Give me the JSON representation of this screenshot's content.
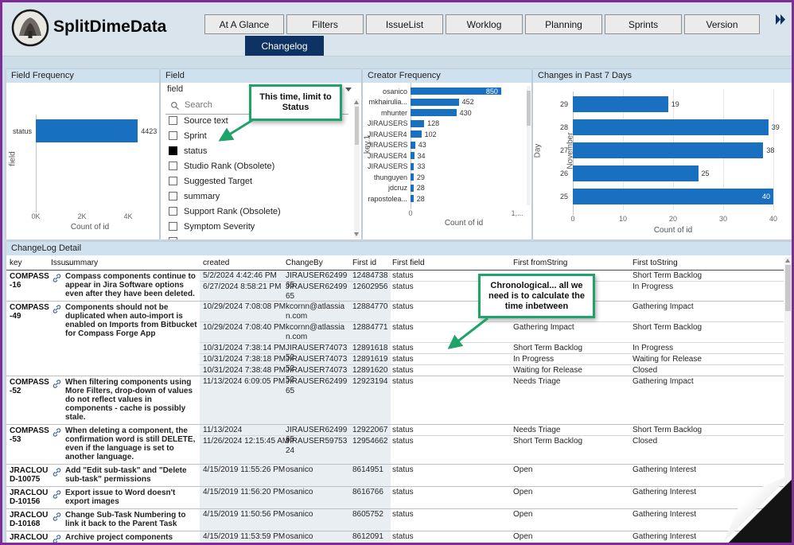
{
  "colors": {
    "bar": "#1a70c0",
    "navy": "#0e3263",
    "green": "#1ea36b",
    "panel_title": "#cfe0ee",
    "page_bg": "#cddde8",
    "header_bg": "#d9e4ec",
    "border_purple": "#7c2d96"
  },
  "header": {
    "app_title": "SplitDimeData",
    "tabs": [
      "At A Glance",
      "Filters",
      "IssueList",
      "Worklog",
      "Planning",
      "Sprints",
      "Version"
    ],
    "active_tab": "Changelog"
  },
  "slicer": {
    "panel_title": "Field",
    "field_label": "field",
    "search_placeholder": "Search",
    "items": [
      {
        "label": "Source text",
        "checked": false
      },
      {
        "label": "Sprint",
        "checked": false
      },
      {
        "label": "status",
        "checked": true
      },
      {
        "label": "Studio Rank (Obsolete)",
        "checked": false
      },
      {
        "label": "Suggested Target",
        "checked": false
      },
      {
        "label": "summary",
        "checked": false
      },
      {
        "label": "Support Rank (Obsolete)",
        "checked": false
      },
      {
        "label": "Symptom Severity",
        "checked": false
      },
      {
        "label": "",
        "checked": false
      }
    ]
  },
  "chart_data": [
    {
      "type": "bar",
      "orientation": "horizontal",
      "title": "Field Frequency",
      "categories": [
        "status"
      ],
      "values": [
        4423
      ],
      "xlabel": "Count of id",
      "ylabel": "field",
      "xticks": [
        "0K",
        "2K",
        "4K"
      ],
      "xlim": [
        0,
        5000
      ],
      "data_labels": true
    },
    {
      "type": "bar",
      "orientation": "horizontal",
      "title": "Creator Frequency",
      "categories": [
        "osanico",
        "mkhairulia...",
        "mhunter",
        "JIRAUSERS...",
        "JIRAUSER4...",
        "JIRAUSERS...",
        "JIRAUSER4...",
        "JIRAUSERS...",
        "thunguyen",
        "jdcruz",
        "rapostolea..."
      ],
      "values": [
        850,
        452,
        430,
        128,
        102,
        43,
        34,
        33,
        29,
        28,
        28
      ],
      "xlabel": "Count of id",
      "ylabel": "key.1",
      "xticks": [
        "0",
        "1,..."
      ],
      "xlim": [
        0,
        1000
      ],
      "data_labels": true
    },
    {
      "type": "bar",
      "orientation": "horizontal",
      "title": "Changes in Past 7 Days",
      "group_label": "November",
      "categories": [
        "29",
        "28",
        "27",
        "26",
        "25"
      ],
      "values": [
        19,
        39,
        38,
        25,
        40
      ],
      "xlabel": "Count of id",
      "ylabel": "Day",
      "xticks": [
        "0",
        "10",
        "20",
        "30",
        "40"
      ],
      "xlim": [
        0,
        40
      ],
      "data_labels": true
    }
  ],
  "callouts": [
    {
      "text": "This time, limit to Status"
    },
    {
      "text": "Chronological... all we need is to calculate the time inbetween"
    }
  ],
  "table": {
    "title": "ChangeLog Detail",
    "columns": [
      "key",
      "Issu...",
      "summary",
      "created",
      "ChangeBy",
      "First id",
      "First field",
      "First fromString",
      "First toString"
    ],
    "groups": [
      {
        "key": "COMPASS-16",
        "summary": "Compass components continue to appear in Jira Software options even after they have been deleted.",
        "rows": [
          {
            "created": "5/2/2024 4:42:46 PM",
            "changeby": "JIRAUSER6249965",
            "first_id": "12484738",
            "first_field": "status",
            "from": "",
            "to": "Short Term Backlog"
          },
          {
            "created": "6/27/2024 8:58:21 PM",
            "changeby": "JIRAUSER6249965",
            "first_id": "12602956",
            "first_field": "status",
            "from": "",
            "to": "In Progress"
          }
        ]
      },
      {
        "key": "COMPASS-49",
        "summary": "Components should not be duplicated when auto-import is enabled on Imports from Bitbucket for Compass Forge App",
        "rows": [
          {
            "created": "10/29/2024 7:08:08 PM",
            "changeby": "kcornn@atlassian.com",
            "first_id": "12884770",
            "first_field": "status",
            "from": "",
            "to": "Gathering Impact"
          },
          {
            "created": "10/29/2024 7:08:40 PM",
            "changeby": "kcornn@atlassian.com",
            "first_id": "12884771",
            "first_field": "status",
            "from": "Gathering Impact",
            "to": "Short Term Backlog"
          },
          {
            "created": "10/31/2024 7:38:14 PM",
            "changeby": "JIRAUSER7407352",
            "first_id": "12891618",
            "first_field": "status",
            "from": "Short Term Backlog",
            "to": "In Progress"
          },
          {
            "created": "10/31/2024 7:38:18 PM",
            "changeby": "JIRAUSER7407352",
            "first_id": "12891619",
            "first_field": "status",
            "from": "In Progress",
            "to": "Waiting for Release"
          },
          {
            "created": "10/31/2024 7:38:48 PM",
            "changeby": "JIRAUSER7407352",
            "first_id": "12891620",
            "first_field": "status",
            "from": "Waiting for Release",
            "to": "Closed"
          }
        ]
      },
      {
        "key": "COMPASS-52",
        "summary": "When filtering components using More Filters, drop-down of values do not reflect values in components - cache is possibly stale.",
        "rows": [
          {
            "created": "11/13/2024 6:09:05 PM",
            "changeby": "JIRAUSER6249965",
            "first_id": "12923194",
            "first_field": "status",
            "from": "Needs Triage",
            "to": "Gathering Impact"
          }
        ]
      },
      {
        "key": "COMPASS-53",
        "summary": "When deleting a component, the confirmation word is still DELETE, even if the language is set to another language.",
        "rows": [
          {
            "created": "11/13/2024",
            "changeby": "JIRAUSER6249965",
            "first_id": "12922067",
            "first_field": "status",
            "from": "Needs Triage",
            "to": "Short Term Backlog"
          },
          {
            "created": "11/26/2024 12:15:45 AM",
            "changeby": "JIRAUSER5975324",
            "first_id": "12954662",
            "first_field": "status",
            "from": "Short Term Backlog",
            "to": "Closed"
          }
        ]
      },
      {
        "key": "JRACLOUD-10075",
        "summary": "Add \"Edit sub-task\" and \"Delete sub-task\" permissions",
        "rows": [
          {
            "created": "4/15/2019 11:55:26 PM",
            "changeby": "osanico",
            "first_id": "8614951",
            "first_field": "status",
            "from": "Open",
            "to": "Gathering Interest"
          }
        ]
      },
      {
        "key": "JRACLOUD-10156",
        "summary": "Export issue to Word doesn't export images",
        "rows": [
          {
            "created": "4/15/2019 11:56:20 PM",
            "changeby": "osanico",
            "first_id": "8616766",
            "first_field": "status",
            "from": "Open",
            "to": "Gathering Interest"
          }
        ]
      },
      {
        "key": "JRACLOUD-10168",
        "summary": "Change Sub-Task Numbering to link it back to the Parent Task",
        "rows": [
          {
            "created": "4/15/2019 11:50:56 PM",
            "changeby": "osanico",
            "first_id": "8605752",
            "first_field": "status",
            "from": "Open",
            "to": "Gathering Interest"
          }
        ]
      },
      {
        "key": "JRACLOUD-",
        "summary": "Archive project components",
        "rows": [
          {
            "created": "4/15/2019 11:53:59 PM",
            "changeby": "osanico",
            "first_id": "8612091",
            "first_field": "status",
            "from": "Open",
            "to": "Gathering Interest"
          }
        ]
      }
    ]
  }
}
